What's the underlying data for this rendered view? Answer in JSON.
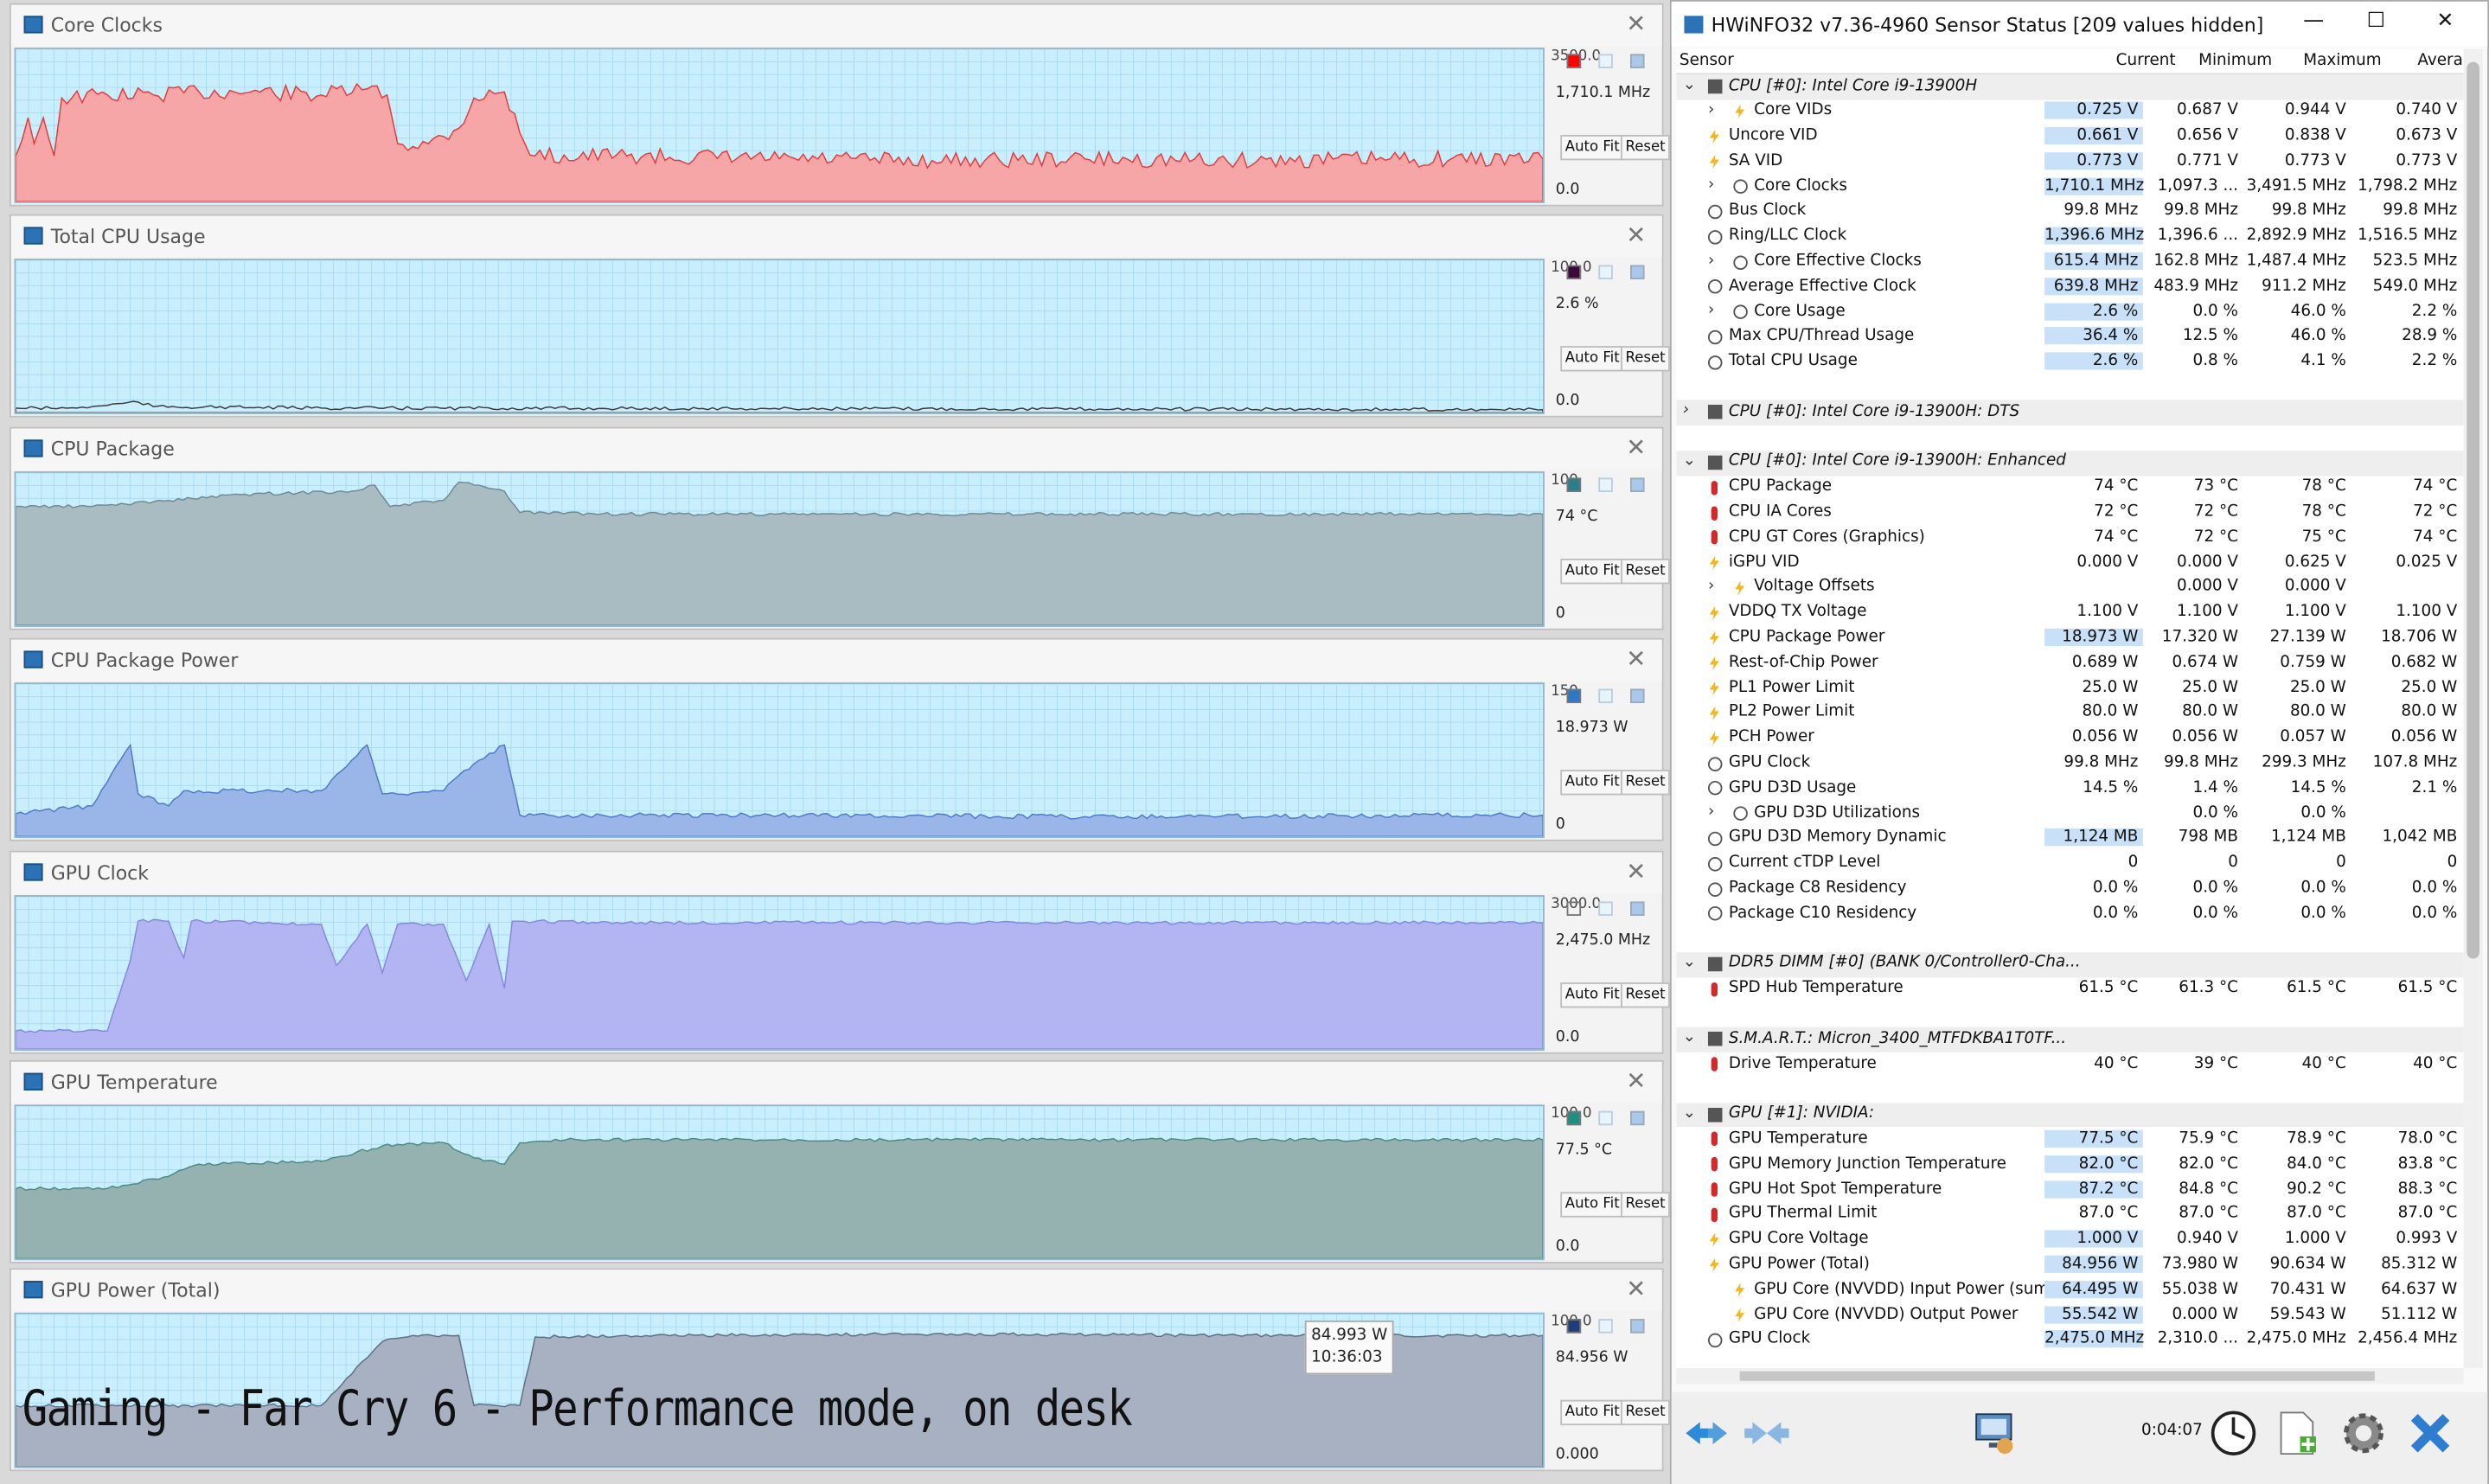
{
  "graphs": [
    {
      "title": "Core Clocks",
      "ymax": "3500.0",
      "current": "1,710.1 MHz",
      "zero": "0.0",
      "color": "#f7a6a8",
      "stroke": "#e53a3a",
      "swatch": "#ff0000",
      "level": 0.39,
      "shape": [
        [
          0,
          0.7
        ],
        [
          0.008,
          0.45
        ],
        [
          0.012,
          0.62
        ],
        [
          0.018,
          0.45
        ],
        [
          0.025,
          0.7
        ],
        [
          0.03,
          0.32
        ],
        [
          0.06,
          0.3
        ],
        [
          0.09,
          0.3
        ],
        [
          0.12,
          0.28
        ],
        [
          0.16,
          0.28
        ],
        [
          0.2,
          0.3
        ],
        [
          0.23,
          0.26
        ],
        [
          0.243,
          0.3
        ],
        [
          0.25,
          0.62
        ],
        [
          0.27,
          0.62
        ],
        [
          0.29,
          0.52
        ],
        [
          0.3,
          0.32
        ],
        [
          0.32,
          0.28
        ],
        [
          0.33,
          0.55
        ],
        [
          0.34,
          0.7
        ],
        [
          0.4,
          0.7
        ],
        [
          0.5,
          0.72
        ],
        [
          0.6,
          0.73
        ],
        [
          0.7,
          0.72
        ],
        [
          0.8,
          0.73
        ],
        [
          0.9,
          0.72
        ],
        [
          1,
          0.72
        ]
      ]
    },
    {
      "title": "Total CPU Usage",
      "ymax": "100.0",
      "current": "2.6 %",
      "zero": "0.0",
      "color": "#c9efff",
      "stroke": "#3a3a3a",
      "swatch": "#3b0a3a",
      "level": 0.026,
      "shape": [
        [
          0,
          0.97
        ],
        [
          0.04,
          0.97
        ],
        [
          0.05,
          0.96
        ],
        [
          0.08,
          0.93
        ],
        [
          0.09,
          0.96
        ],
        [
          0.2,
          0.97
        ],
        [
          1,
          0.98
        ]
      ]
    },
    {
      "title": "CPU Package",
      "ymax": "100",
      "current": "74 °C",
      "zero": "0",
      "color": "#a9bcc2",
      "stroke": "#6f8a92",
      "swatch": "#2e7d8a",
      "level": 0.74,
      "shape": [
        [
          0,
          0.22
        ],
        [
          0.05,
          0.22
        ],
        [
          0.1,
          0.18
        ],
        [
          0.15,
          0.14
        ],
        [
          0.22,
          0.12
        ],
        [
          0.235,
          0.08
        ],
        [
          0.245,
          0.22
        ],
        [
          0.28,
          0.18
        ],
        [
          0.29,
          0.06
        ],
        [
          0.32,
          0.12
        ],
        [
          0.33,
          0.26
        ],
        [
          0.4,
          0.27
        ],
        [
          0.6,
          0.27
        ],
        [
          0.8,
          0.27
        ],
        [
          1,
          0.27
        ]
      ]
    },
    {
      "title": "CPU Package Power",
      "ymax": "150",
      "current": "18.973 W",
      "zero": "0",
      "color": "#9ab6e8",
      "stroke": "#4e79c7",
      "swatch": "#2b78c8",
      "level": 0.126,
      "shape": [
        [
          0,
          0.85
        ],
        [
          0.05,
          0.8
        ],
        [
          0.075,
          0.4
        ],
        [
          0.08,
          0.72
        ],
        [
          0.1,
          0.8
        ],
        [
          0.11,
          0.7
        ],
        [
          0.2,
          0.7
        ],
        [
          0.23,
          0.4
        ],
        [
          0.24,
          0.72
        ],
        [
          0.28,
          0.7
        ],
        [
          0.29,
          0.6
        ],
        [
          0.32,
          0.4
        ],
        [
          0.33,
          0.86
        ],
        [
          0.5,
          0.86
        ],
        [
          0.7,
          0.87
        ],
        [
          1,
          0.86
        ]
      ]
    },
    {
      "title": "GPU Clock",
      "ymax": "3000.0",
      "current": "2,475.0 MHz",
      "zero": "0.0",
      "color": "#b3b5f3",
      "stroke": "#8587dc",
      "swatch": "",
      "level": 0.825,
      "shape": [
        [
          0,
          0.88
        ],
        [
          0.06,
          0.88
        ],
        [
          0.075,
          0.42
        ],
        [
          0.08,
          0.16
        ],
        [
          0.1,
          0.16
        ],
        [
          0.11,
          0.4
        ],
        [
          0.115,
          0.16
        ],
        [
          0.2,
          0.18
        ],
        [
          0.21,
          0.45
        ],
        [
          0.23,
          0.18
        ],
        [
          0.24,
          0.5
        ],
        [
          0.25,
          0.18
        ],
        [
          0.28,
          0.18
        ],
        [
          0.295,
          0.55
        ],
        [
          0.31,
          0.18
        ],
        [
          0.32,
          0.6
        ],
        [
          0.325,
          0.16
        ],
        [
          0.33,
          0.16
        ],
        [
          0.4,
          0.17
        ],
        [
          0.7,
          0.17
        ],
        [
          1,
          0.17
        ]
      ]
    },
    {
      "title": "GPU Temperature",
      "ymax": "100.0",
      "current": "77.5 °C",
      "zero": "0.0",
      "color": "#95b2b0",
      "stroke": "#4a8a86",
      "swatch": "#1f8f83",
      "level": 0.775,
      "shape": [
        [
          0,
          0.54
        ],
        [
          0.06,
          0.54
        ],
        [
          0.1,
          0.46
        ],
        [
          0.12,
          0.38
        ],
        [
          0.2,
          0.36
        ],
        [
          0.24,
          0.26
        ],
        [
          0.28,
          0.24
        ],
        [
          0.3,
          0.34
        ],
        [
          0.32,
          0.38
        ],
        [
          0.33,
          0.24
        ],
        [
          0.36,
          0.22
        ],
        [
          0.5,
          0.22
        ],
        [
          0.7,
          0.22
        ],
        [
          1,
          0.22
        ]
      ]
    },
    {
      "title": "GPU Power (Total)",
      "ymax": "100.0",
      "current": "84.956 W",
      "zero": "0.000",
      "color": "#a7b1c1",
      "stroke": "#5f6e85",
      "swatch": "#1f3d7a",
      "level": 0.85,
      "shape": [
        [
          0,
          0.6
        ],
        [
          0.2,
          0.6
        ],
        [
          0.24,
          0.18
        ],
        [
          0.26,
          0.14
        ],
        [
          0.29,
          0.14
        ],
        [
          0.3,
          0.6
        ],
        [
          0.33,
          0.6
        ],
        [
          0.34,
          0.15
        ],
        [
          0.4,
          0.14
        ],
        [
          0.6,
          0.13
        ],
        [
          0.8,
          0.14
        ],
        [
          1,
          0.14
        ]
      ]
    }
  ],
  "buttons": {
    "auto_fit": "Auto Fit",
    "reset": "Reset"
  },
  "tooltip": {
    "value": "84.993 W",
    "time": "10:36:03"
  },
  "caption": "Gaming - Far Cry 6 - Performance mode, on desk",
  "hwinfo": {
    "title": "HWiNFO32 v7.36-4960 Sensor Status [209 values hidden]",
    "columns": [
      "Sensor",
      "Current",
      "Minimum",
      "Maximum",
      "Average"
    ],
    "timer": "0:04:07",
    "rows": [
      {
        "t": "sec",
        "name": "CPU [#0]: Intel Core i9-13900H",
        "exp": "∨"
      },
      {
        "name": "Core VIDs",
        "icon": "bolt",
        "ind": 1,
        "exp": ">",
        "c": "0.725 V",
        "mn": "0.687 V",
        "mx": "0.944 V",
        "av": "0.740 V",
        "hl": 1
      },
      {
        "name": "Uncore VID",
        "icon": "bolt",
        "c": "0.661 V",
        "mn": "0.656 V",
        "mx": "0.838 V",
        "av": "0.673 V",
        "hl": 1
      },
      {
        "name": "SA VID",
        "icon": "bolt",
        "c": "0.773 V",
        "mn": "0.771 V",
        "mx": "0.773 V",
        "av": "0.773 V",
        "hl": 1
      },
      {
        "name": "Core Clocks",
        "icon": "clock",
        "ind": 1,
        "exp": ">",
        "c": "1,710.1 MHz",
        "mn": "1,097.3 ...",
        "mx": "3,491.5 MHz",
        "av": "1,798.2 MHz",
        "hl": 1
      },
      {
        "name": "Bus Clock",
        "icon": "clock",
        "c": "99.8 MHz",
        "mn": "99.8 MHz",
        "mx": "99.8 MHz",
        "av": "99.8 MHz"
      },
      {
        "name": "Ring/LLC Clock",
        "icon": "clock",
        "c": "1,396.6 MHz",
        "mn": "1,396.6 ...",
        "mx": "2,892.9 MHz",
        "av": "1,516.5 MHz",
        "hl": 1
      },
      {
        "name": "Core Effective Clocks",
        "icon": "clock",
        "ind": 1,
        "exp": ">",
        "c": "615.4 MHz",
        "mn": "162.8 MHz",
        "mx": "1,487.4 MHz",
        "av": "523.5 MHz",
        "hl": 1
      },
      {
        "name": "Average Effective Clock",
        "icon": "clock",
        "c": "639.8 MHz",
        "mn": "483.9 MHz",
        "mx": "911.2 MHz",
        "av": "549.0 MHz",
        "hl": 1
      },
      {
        "name": "Core Usage",
        "icon": "clock",
        "ind": 1,
        "exp": ">",
        "c": "2.6 %",
        "mn": "0.0 %",
        "mx": "46.0 %",
        "av": "2.2 %",
        "hl": 1
      },
      {
        "name": "Max CPU/Thread Usage",
        "icon": "clock",
        "c": "36.4 %",
        "mn": "12.5 %",
        "mx": "46.0 %",
        "av": "28.9 %",
        "hl": 1
      },
      {
        "name": "Total CPU Usage",
        "icon": "clock",
        "c": "2.6 %",
        "mn": "0.8 %",
        "mx": "4.1 %",
        "av": "2.2 %",
        "hl": 1
      },
      {
        "t": "blank"
      },
      {
        "t": "sec",
        "name": "CPU [#0]: Intel Core i9-13900H: DTS",
        "exp": ">"
      },
      {
        "t": "blank"
      },
      {
        "t": "sec",
        "name": "CPU [#0]: Intel Core i9-13900H: Enhanced",
        "exp": "∨"
      },
      {
        "name": "CPU Package",
        "icon": "therm",
        "c": "74 °C",
        "mn": "73 °C",
        "mx": "78 °C",
        "av": "74 °C"
      },
      {
        "name": "CPU IA Cores",
        "icon": "therm",
        "c": "72 °C",
        "mn": "72 °C",
        "mx": "78 °C",
        "av": "72 °C"
      },
      {
        "name": "CPU GT Cores (Graphics)",
        "icon": "therm",
        "c": "74 °C",
        "mn": "72 °C",
        "mx": "75 °C",
        "av": "74 °C"
      },
      {
        "name": "iGPU VID",
        "icon": "bolt",
        "c": "0.000 V",
        "mn": "0.000 V",
        "mx": "0.625 V",
        "av": "0.025 V"
      },
      {
        "name": "Voltage Offsets",
        "icon": "bolt",
        "ind": 1,
        "exp": ">",
        "c": "",
        "mn": "0.000 V",
        "mx": "0.000 V",
        "av": ""
      },
      {
        "name": "VDDQ TX Voltage",
        "icon": "bolt",
        "c": "1.100 V",
        "mn": "1.100 V",
        "mx": "1.100 V",
        "av": "1.100 V"
      },
      {
        "name": "CPU Package Power",
        "icon": "bolt",
        "c": "18.973 W",
        "mn": "17.320 W",
        "mx": "27.139 W",
        "av": "18.706 W",
        "hl": 1
      },
      {
        "name": "Rest-of-Chip Power",
        "icon": "bolt",
        "c": "0.689 W",
        "mn": "0.674 W",
        "mx": "0.759 W",
        "av": "0.682 W"
      },
      {
        "name": "PL1 Power Limit",
        "icon": "bolt",
        "c": "25.0 W",
        "mn": "25.0 W",
        "mx": "25.0 W",
        "av": "25.0 W"
      },
      {
        "name": "PL2 Power Limit",
        "icon": "bolt",
        "c": "80.0 W",
        "mn": "80.0 W",
        "mx": "80.0 W",
        "av": "80.0 W"
      },
      {
        "name": "PCH Power",
        "icon": "bolt",
        "c": "0.056 W",
        "mn": "0.056 W",
        "mx": "0.057 W",
        "av": "0.056 W"
      },
      {
        "name": "GPU Clock",
        "icon": "clock",
        "c": "99.8 MHz",
        "mn": "99.8 MHz",
        "mx": "299.3 MHz",
        "av": "107.8 MHz"
      },
      {
        "name": "GPU D3D Usage",
        "icon": "clock",
        "c": "14.5 %",
        "mn": "1.4 %",
        "mx": "14.5 %",
        "av": "2.1 %"
      },
      {
        "name": "GPU D3D Utilizations",
        "icon": "clock",
        "ind": 1,
        "exp": ">",
        "c": "",
        "mn": "0.0 %",
        "mx": "0.0 %",
        "av": ""
      },
      {
        "name": "GPU D3D Memory Dynamic",
        "icon": "clock",
        "c": "1,124 MB",
        "mn": "798 MB",
        "mx": "1,124 MB",
        "av": "1,042 MB",
        "hl": 1
      },
      {
        "name": "Current cTDP Level",
        "icon": "clock",
        "c": "0",
        "mn": "0",
        "mx": "0",
        "av": "0"
      },
      {
        "name": "Package C8 Residency",
        "icon": "clock",
        "c": "0.0 %",
        "mn": "0.0 %",
        "mx": "0.0 %",
        "av": "0.0 %"
      },
      {
        "name": "Package C10 Residency",
        "icon": "clock",
        "c": "0.0 %",
        "mn": "0.0 %",
        "mx": "0.0 %",
        "av": "0.0 %"
      },
      {
        "t": "blank"
      },
      {
        "t": "sec",
        "name": "DDR5 DIMM [#0] (BANK 0/Controller0-Cha...",
        "exp": "∨"
      },
      {
        "name": "SPD Hub Temperature",
        "icon": "therm",
        "c": "61.5 °C",
        "mn": "61.3 °C",
        "mx": "61.5 °C",
        "av": "61.5 °C"
      },
      {
        "t": "blank"
      },
      {
        "t": "sec",
        "name": "S.M.A.R.T.: Micron_3400_MTFDKBA1T0TF...",
        "exp": "∨"
      },
      {
        "name": "Drive Temperature",
        "icon": "therm",
        "c": "40 °C",
        "mn": "39 °C",
        "mx": "40 °C",
        "av": "40 °C"
      },
      {
        "t": "blank"
      },
      {
        "t": "sec",
        "name": "GPU [#1]: NVIDIA:",
        "exp": "∨"
      },
      {
        "name": "GPU Temperature",
        "icon": "therm",
        "c": "77.5 °C",
        "mn": "75.9 °C",
        "mx": "78.9 °C",
        "av": "78.0 °C",
        "hl": 1
      },
      {
        "name": "GPU Memory Junction Temperature",
        "icon": "therm",
        "c": "82.0 °C",
        "mn": "82.0 °C",
        "mx": "84.0 °C",
        "av": "83.8 °C",
        "hl": 1
      },
      {
        "name": "GPU Hot Spot Temperature",
        "icon": "therm",
        "c": "87.2 °C",
        "mn": "84.8 °C",
        "mx": "90.2 °C",
        "av": "88.3 °C",
        "hl": 1
      },
      {
        "name": "GPU Thermal Limit",
        "icon": "therm",
        "c": "87.0 °C",
        "mn": "87.0 °C",
        "mx": "87.0 °C",
        "av": "87.0 °C"
      },
      {
        "name": "GPU Core Voltage",
        "icon": "bolt",
        "c": "1.000 V",
        "mn": "0.940 V",
        "mx": "1.000 V",
        "av": "0.993 V",
        "hl": 1
      },
      {
        "name": "GPU Power (Total)",
        "icon": "bolt",
        "c": "84.956 W",
        "mn": "73.980 W",
        "mx": "90.634 W",
        "av": "85.312 W",
        "hl": 1
      },
      {
        "name": "GPU Core (NVVDD) Input Power (sum)",
        "icon": "bolt",
        "ind": 1,
        "c": "64.495 W",
        "mn": "55.038 W",
        "mx": "70.431 W",
        "av": "64.637 W",
        "hl": 1
      },
      {
        "name": "GPU Core (NVVDD) Output Power",
        "icon": "bolt",
        "ind": 1,
        "c": "55.542 W",
        "mn": "0.000 W",
        "mx": "59.543 W",
        "av": "51.112 W",
        "hl": 1
      },
      {
        "name": "GPU Clock",
        "icon": "clock",
        "c": "2,475.0 MHz",
        "mn": "2,310.0 ...",
        "mx": "2,475.0 MHz",
        "av": "2,456.4 MHz",
        "hl": 1
      }
    ]
  }
}
